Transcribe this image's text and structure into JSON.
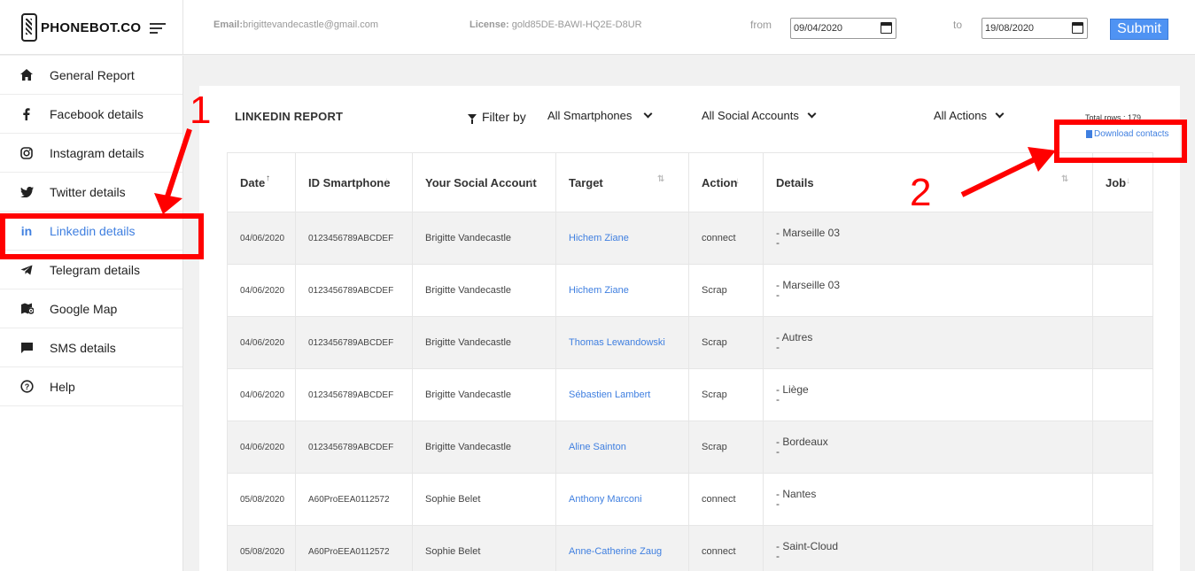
{
  "brand": {
    "name": "PHONEBOT.CO"
  },
  "header": {
    "email_label": "Email:",
    "email_value": "brigittevandecastle@gmail.com",
    "license_label": "License:",
    "license_value": "gold85DE-BAWI-HQ2E-D8UR",
    "from_label": "from",
    "from_value": "09/04/2020",
    "to_label": "to",
    "to_value": "19/08/2020",
    "submit_label": "Submit"
  },
  "sidebar": {
    "items": [
      {
        "label": "General Report",
        "icon": "home-icon"
      },
      {
        "label": "Facebook details",
        "icon": "facebook-icon"
      },
      {
        "label": "Instagram details",
        "icon": "instagram-icon"
      },
      {
        "label": "Twitter details",
        "icon": "twitter-icon"
      },
      {
        "label": "Linkedin details",
        "icon": "linkedin-icon",
        "active": true
      },
      {
        "label": "Telegram details",
        "icon": "telegram-icon"
      },
      {
        "label": "Google Map",
        "icon": "map-icon"
      },
      {
        "label": "SMS details",
        "icon": "sms-icon"
      },
      {
        "label": "Help",
        "icon": "help-icon"
      }
    ]
  },
  "report": {
    "title": "LINKEDIN REPORT",
    "filter_label": "Filter by",
    "filter_smartphones": "All Smartphones",
    "filter_accounts": "All Social Accounts",
    "filter_actions": "All Actions",
    "total_rows": "Total rows : 179",
    "download_label": "Download contacts"
  },
  "table": {
    "columns": [
      "Date",
      "ID Smartphone",
      "Your Social Account",
      "Target",
      "Action",
      "Details",
      "Job"
    ],
    "rows": [
      {
        "date": "04/06/2020",
        "id": "0123456789ABCDEF",
        "account": "Brigitte Vandecastle",
        "target": "Hichem Ziane",
        "action": "connect",
        "details": "- Marseille 03"
      },
      {
        "date": "04/06/2020",
        "id": "0123456789ABCDEF",
        "account": "Brigitte Vandecastle",
        "target": "Hichem Ziane",
        "action": "Scrap",
        "details": "- Marseille 03"
      },
      {
        "date": "04/06/2020",
        "id": "0123456789ABCDEF",
        "account": "Brigitte Vandecastle",
        "target": "Thomas Lewandowski",
        "action": "Scrap",
        "details": "- Autres"
      },
      {
        "date": "04/06/2020",
        "id": "0123456789ABCDEF",
        "account": "Brigitte Vandecastle",
        "target": "Sébastien Lambert",
        "action": "Scrap",
        "details": "- Liège"
      },
      {
        "date": "04/06/2020",
        "id": "0123456789ABCDEF",
        "account": "Brigitte Vandecastle",
        "target": "Aline Sainton",
        "action": "Scrap",
        "details": "- Bordeaux"
      },
      {
        "date": "05/08/2020",
        "id": "A60ProEEA0112572",
        "account": "Sophie Belet",
        "target": "Anthony Marconi",
        "action": "connect",
        "details": "- Nantes"
      },
      {
        "date": "05/08/2020",
        "id": "A60ProEEA0112572",
        "account": "Sophie Belet",
        "target": "Anne-Catherine Zaug",
        "action": "connect",
        "details": "- Saint-Cloud"
      }
    ]
  },
  "annotations": {
    "one": "1",
    "two": "2",
    "color": "#ff0000"
  }
}
